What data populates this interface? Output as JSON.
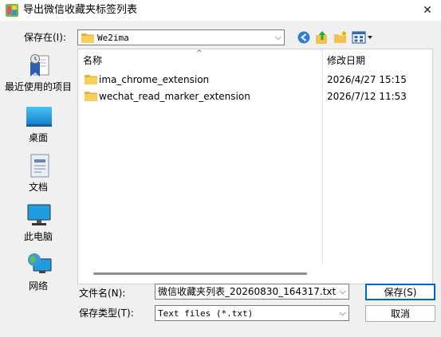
{
  "window": {
    "title": "导出微信收藏夹标签列表",
    "close_glyph": "✕"
  },
  "save_in": {
    "label": "保存在(I):",
    "value": "We2ima",
    "arrow": "⌵"
  },
  "places": [
    {
      "label": "最近使用的项目",
      "icon": "recent-icon"
    },
    {
      "label": "桌面",
      "icon": "desktop-icon"
    },
    {
      "label": "文档",
      "icon": "documents-icon"
    },
    {
      "label": "此电脑",
      "icon": "computer-icon"
    },
    {
      "label": "网络",
      "icon": "network-icon"
    }
  ],
  "file_list": {
    "columns": {
      "name": "名称",
      "date": "修改日期"
    },
    "sort_glyph": "^",
    "rows": [
      {
        "name": "ima_chrome_extension",
        "date": "2026/4/27 15:15"
      },
      {
        "name": "wechat_read_marker_extension",
        "date": "2026/7/12 11:53"
      }
    ]
  },
  "filename": {
    "label": "文件名(N):",
    "value": "微信收藏夹列表_20260830_164317.txt",
    "arrow": "⌵"
  },
  "filetype": {
    "label": "保存类型(T):",
    "value": "Text files (*.txt)",
    "arrow": "⌵"
  },
  "buttons": {
    "save": "保存(S)",
    "cancel": "取消"
  },
  "colors": {
    "folder": "#f5c542",
    "accent": "#0067c0"
  }
}
